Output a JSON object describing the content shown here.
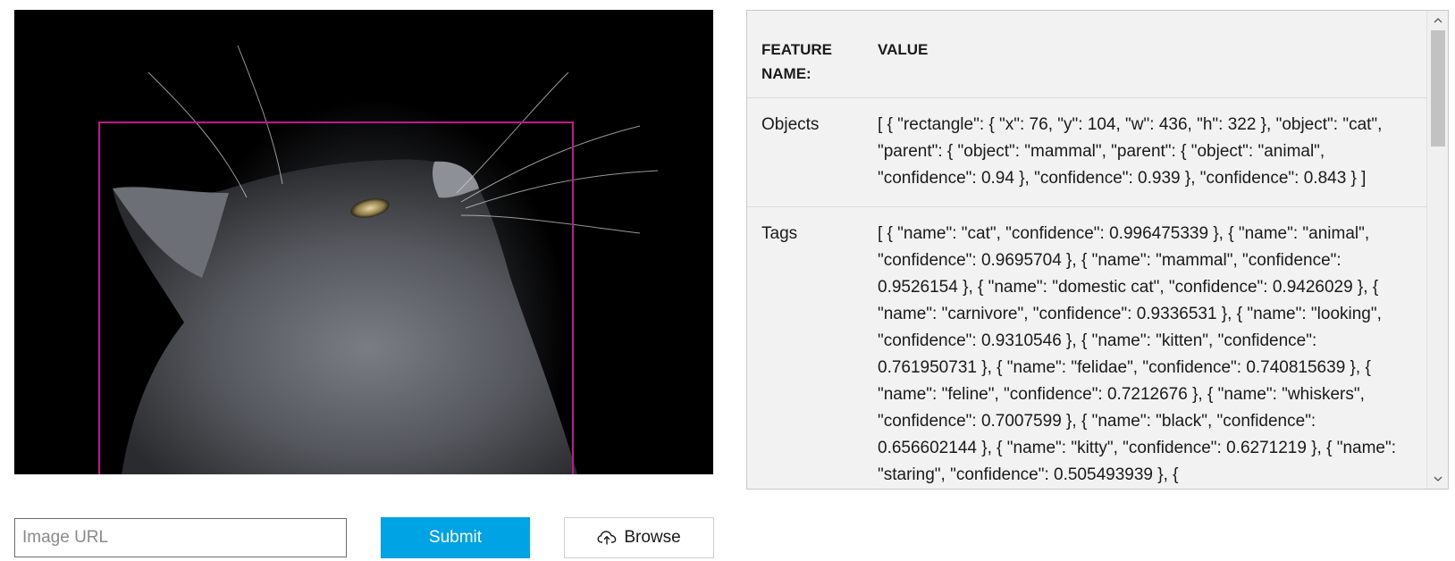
{
  "image": {
    "subject_icon": "cat-photo",
    "bbox_color": "#c0168f"
  },
  "form": {
    "url_placeholder": "Image URL",
    "url_value": "",
    "submit_label": "Submit",
    "browse_label": "Browse",
    "browse_icon": "cloud-upload-icon"
  },
  "results": {
    "headers": {
      "feature": "FEATURE NAME:",
      "value": "VALUE"
    },
    "rows": [
      {
        "feature": "Objects",
        "value": "[ { \"rectangle\": { \"x\": 76, \"y\": 104, \"w\": 436, \"h\": 322 }, \"object\": \"cat\", \"parent\": { \"object\": \"mammal\", \"parent\": { \"object\": \"animal\", \"confidence\": 0.94 }, \"confidence\": 0.939 }, \"confidence\": 0.843 } ]"
      },
      {
        "feature": "Tags",
        "value": "[ { \"name\": \"cat\", \"confidence\": 0.996475339 }, { \"name\": \"animal\", \"confidence\": 0.9695704 }, { \"name\": \"mammal\", \"confidence\": 0.9526154 }, { \"name\": \"domestic cat\", \"confidence\": 0.9426029 }, { \"name\": \"carnivore\", \"confidence\": 0.9336531 }, { \"name\": \"looking\", \"confidence\": 0.9310546 }, { \"name\": \"kitten\", \"confidence\": 0.761950731 }, { \"name\": \"felidae\", \"confidence\": 0.740815639 }, { \"name\": \"feline\", \"confidence\": 0.7212676 }, { \"name\": \"whiskers\", \"confidence\": 0.7007599 }, { \"name\": \"black\", \"confidence\": 0.656602144 }, { \"name\": \"kitty\", \"confidence\": 0.6271219 }, { \"name\": \"staring\", \"confidence\": 0.505493939 }, {"
      }
    ]
  },
  "colors": {
    "accent": "#00a4e4",
    "panel_bg": "#f2f2f2"
  }
}
